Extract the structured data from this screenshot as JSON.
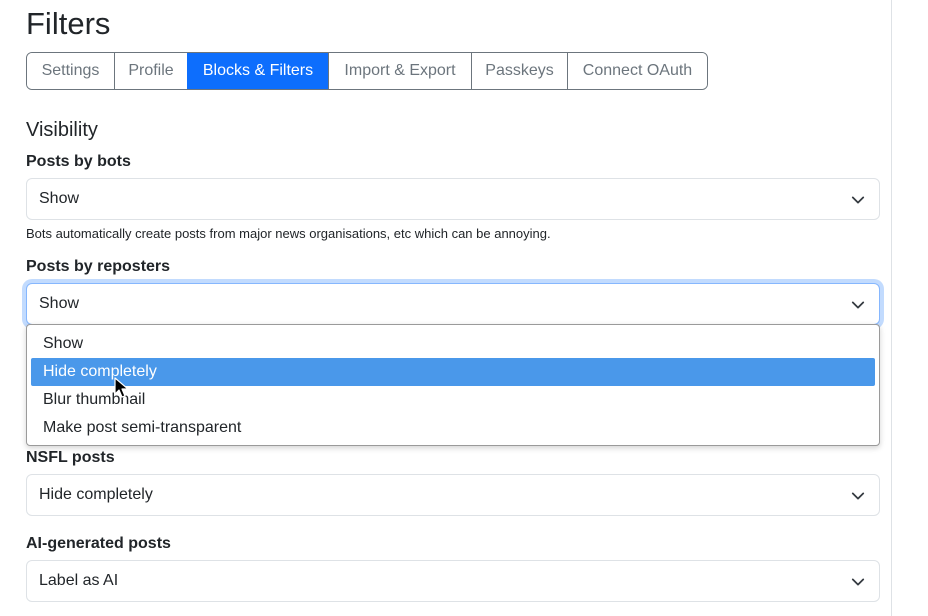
{
  "page": {
    "title": "Filters"
  },
  "tabs": [
    {
      "label": "Settings",
      "active": false
    },
    {
      "label": "Profile",
      "active": false
    },
    {
      "label": "Blocks & Filters",
      "active": true
    },
    {
      "label": "Import & Export",
      "active": false
    },
    {
      "label": "Passkeys",
      "active": false
    },
    {
      "label": "Connect OAuth",
      "active": false
    }
  ],
  "visibility": {
    "title": "Visibility",
    "bots": {
      "label": "Posts by bots",
      "value": "Show",
      "help": "Bots automatically create posts from major news organisations, etc which can be annoying."
    },
    "reposters": {
      "label": "Posts by reposters",
      "value": "Show",
      "open": true,
      "options": [
        "Show",
        "Hide completely",
        "Blur thumbnail",
        "Make post semi-transparent"
      ],
      "highlighted_option": "Hide completely"
    },
    "nsfl": {
      "label": "NSFL posts",
      "value": "Hide completely"
    },
    "ai": {
      "label": "AI-generated posts",
      "value": "Label as AI"
    }
  },
  "colors": {
    "accent": "#0d6efd",
    "option_highlight": "#4a98ea",
    "focus_border": "#86b7fe"
  },
  "icons": {
    "select_caret": "chevron-down-icon",
    "pointer": "mouse-cursor-icon"
  }
}
